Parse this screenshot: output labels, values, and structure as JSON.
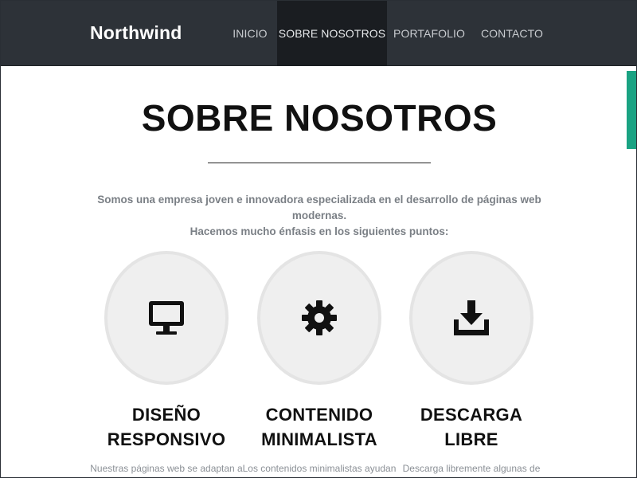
{
  "navbar": {
    "brand": "Northwind",
    "items": [
      {
        "label": "INICIO",
        "active": false
      },
      {
        "label": "SOBRE NOSOTROS",
        "active": true
      },
      {
        "label": "PORTAFOLIO",
        "active": false
      },
      {
        "label": "CONTACTO",
        "active": false
      }
    ]
  },
  "section": {
    "title": "SOBRE NOSOTROS",
    "intro_line1": "Somos una empresa joven e innovadora especializada en el desarrollo de páginas web modernas.",
    "intro_line2": "Hacemos mucho énfasis en los siguientes puntos:"
  },
  "features": [
    {
      "icon": "monitor-icon",
      "title_line1": "DISEÑO",
      "title_line2": "RESPONSIVO",
      "text": "Nuestras páginas web se adaptan a"
    },
    {
      "icon": "gear-icon",
      "title_line1": "CONTENIDO",
      "title_line2": "MINIMALISTA",
      "text": "Los contenidos minimalistas ayudan"
    },
    {
      "icon": "download-icon",
      "title_line1": "DESCARGA",
      "title_line2": "LIBRE",
      "text": "Descarga libremente algunas de"
    }
  ],
  "colors": {
    "navbar_bg": "#2d3238",
    "navbar_active_bg": "#1a1d21",
    "accent": "#1aa383",
    "title": "#111111",
    "muted_text": "#7a7f85"
  }
}
